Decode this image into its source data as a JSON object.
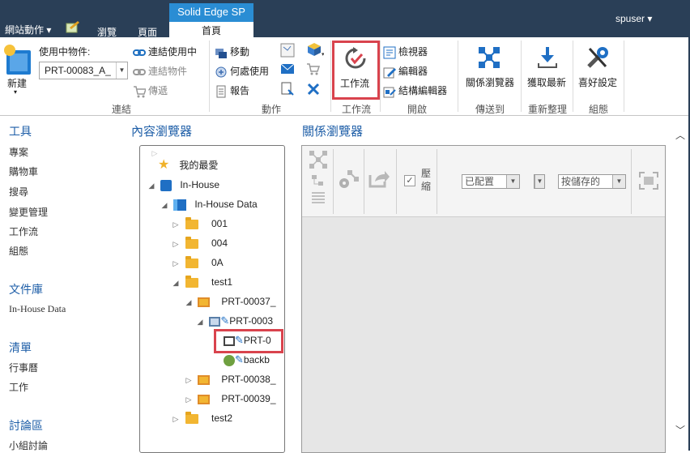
{
  "topbar": {
    "site_actions": "網站動作 ▾",
    "browse": "瀏覽",
    "page": "頁面",
    "app_label": "Solid Edge SP",
    "home_tab": "首頁",
    "user": "spuser ▾"
  },
  "ribbon": {
    "new_label": "新建",
    "new_arrow": "▾",
    "object_in_use_label": "使用中物件:",
    "object_combo_value": "PRT-00083_A_",
    "link_in_use": "連結使用中",
    "link_object": "連結物件",
    "send": "傳遞",
    "group_link": "連結",
    "move": "移動",
    "where_used": "何處使用",
    "report": "報告",
    "group_action": "動作",
    "workflow_button": "工作流",
    "group_workflow": "工作流",
    "viewer": "檢視器",
    "editor": "編輯器",
    "structure_editor": "結構編輯器",
    "group_open": "開啟",
    "relation_browser": "關係瀏覽器",
    "group_send_to": "傳送到",
    "get_latest": "獲取最新",
    "group_refresh": "重新整理",
    "preferences": "喜好設定",
    "group_config": "組態"
  },
  "leftnav": {
    "tools_head": "工具",
    "tools": [
      "專案",
      "購物車",
      "搜尋",
      "變更管理",
      "工作流",
      "組態"
    ],
    "library_head": "文件庫",
    "library": [
      "In-House Data"
    ],
    "list_head": "清單",
    "lists": [
      "行事曆",
      "工作"
    ],
    "discussion_head": "討論區",
    "discussions": [
      "小組討論"
    ]
  },
  "content_browser": {
    "title": "內容瀏覽器",
    "tree": {
      "favorites": "我的最愛",
      "inhouse": "In-House",
      "inhouse_data": "In-House Data",
      "f001": "001",
      "f004": "004",
      "f0A": "0A",
      "test1": "test1",
      "prt37": "PRT-00037_",
      "prt37child": "PRT-0003",
      "prt0": "PRT-0",
      "backb": "backb",
      "prt38": "PRT-00038_",
      "prt39": "PRT-00039_",
      "test2": "test2"
    }
  },
  "relation_browser": {
    "title": "關係瀏覽器",
    "compress_label": "壓縮",
    "layout_select": "已配置",
    "save_select": "按儲存的"
  },
  "colors": {
    "topbar": "#2a3f57",
    "accent": "#2a8dd4",
    "highlight_red": "#d9434d",
    "heading_blue": "#1f5fa8"
  }
}
